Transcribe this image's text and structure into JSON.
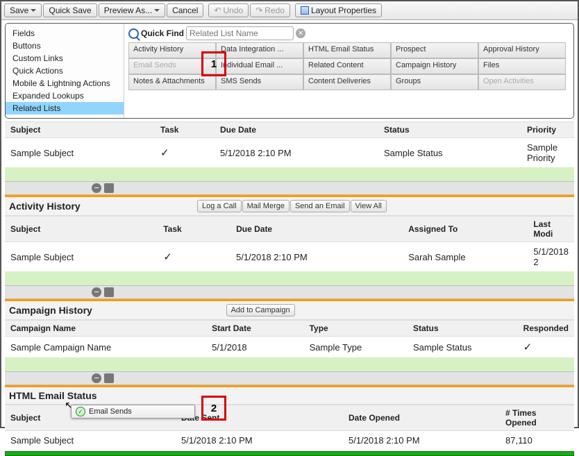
{
  "toolbar": {
    "save": "Save",
    "quicksave": "Quick Save",
    "preview": "Preview As...",
    "cancel": "Cancel",
    "undo": "Undo",
    "redo": "Redo",
    "layout": "Layout Properties"
  },
  "sidebar": [
    "Fields",
    "Buttons",
    "Custom Links",
    "Quick Actions",
    "Mobile & Lightning Actions",
    "Expanded Lookups",
    "Related Lists"
  ],
  "quickfind": {
    "label": "Quick Find",
    "placeholder": "Related List Name"
  },
  "palette": [
    [
      "Activity History",
      "Data Integration ...",
      "HTML Email Status",
      "Prospect"
    ],
    [
      "Approval History",
      "Email Sends",
      "Individual Email ...",
      "Related Content"
    ],
    [
      "Campaign History",
      "Files",
      "Notes & Attachments",
      "SMS Sends"
    ],
    [
      "Content Deliveries",
      "Groups",
      "Open Activities",
      ""
    ]
  ],
  "palette_disabled": [
    "Email Sends",
    "Open Activities"
  ],
  "callouts": {
    "one": "1",
    "two": "2"
  },
  "sections": {
    "openAct": {
      "cols": [
        "Subject",
        "Task",
        "Due Date",
        "Status",
        "Priority"
      ],
      "row": [
        "Sample Subject",
        "✓",
        "5/1/2018 2:10 PM",
        "Sample Status",
        "Sample Priority"
      ]
    },
    "actHist": {
      "title": "Activity History",
      "btns": [
        "Log a Call",
        "Mail Merge",
        "Send an Email",
        "View All"
      ],
      "cols": [
        "Subject",
        "Task",
        "Due Date",
        "Assigned To",
        "Last Modi"
      ],
      "row": [
        "Sample Subject",
        "✓",
        "5/1/2018 2:10 PM",
        "Sarah Sample",
        "5/1/2018 2"
      ]
    },
    "camp": {
      "title": "Campaign History",
      "btns": [
        "Add to Campaign"
      ],
      "cols": [
        "Campaign Name",
        "Start Date",
        "Type",
        "Status",
        "Responded"
      ],
      "row": [
        "Sample Campaign Name",
        "5/1/2018",
        "Sample Type",
        "Sample Status",
        "✓"
      ]
    },
    "html": {
      "title": "HTML Email Status",
      "cols": [
        "Subject",
        "Date Sent",
        "Date Opened",
        "# Times Opened"
      ],
      "row": [
        "Sample Subject",
        "5/1/2018 2:10 PM",
        "5/1/2018 2:10 PM",
        "87,110"
      ]
    }
  },
  "drag": {
    "label": "Email Sends"
  }
}
